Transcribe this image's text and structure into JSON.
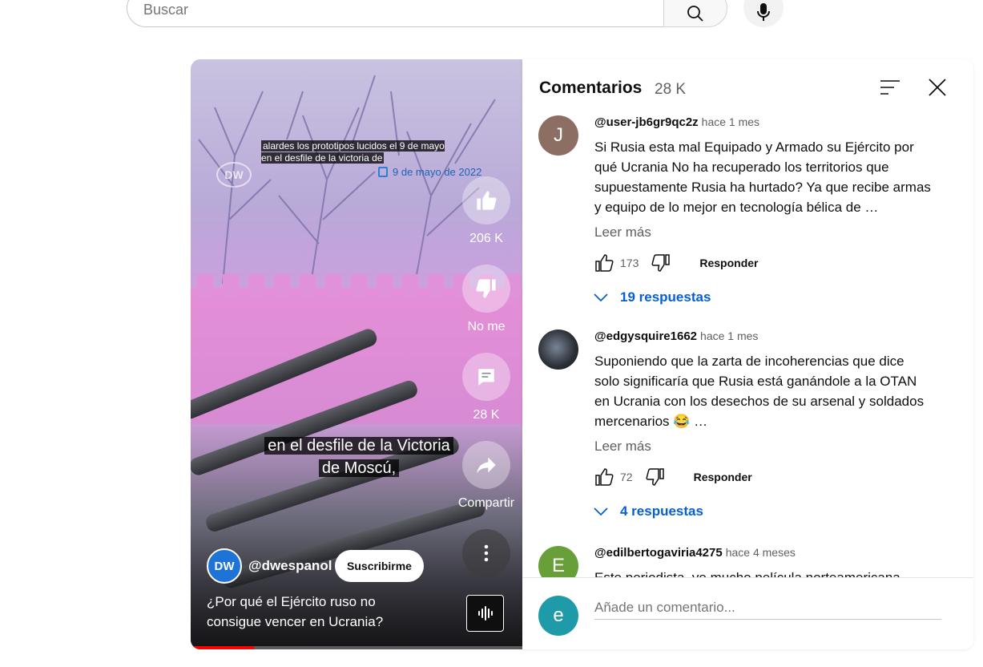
{
  "search": {
    "placeholder": "Buscar"
  },
  "video": {
    "caption_top": "alardes los prototipos lucidos el 9 de mayo en el desfile de la victoria de",
    "date": "9 de mayo de 2022",
    "subtitle_line1": "en el desfile de la Victoria",
    "subtitle_line2": "de Moscú,",
    "like_count": "206 K",
    "dislike_label": "No me",
    "comment_count": "28 K",
    "share_label": "Compartir",
    "channel_handle": "@dwespanol",
    "channel_logo": "DW",
    "subscribe_label": "Suscribirme",
    "title": "¿Por qué el Ejército ruso no consigue vencer en Ucrania?",
    "progress": 0.19
  },
  "comments": {
    "title": "Comentarios",
    "count": "28 K",
    "items": [
      {
        "avatar_letter": "J",
        "avatar_color": "#8d6e63",
        "handle": "@user-jb6gr9qc2z",
        "time": "hace 1 mes",
        "text": "Si Rusia esta mal Equipado y Armado su Ejército por qué Ucrania No ha recuperado los territorios que supuestamente Rusia ha hurtado? Ya que recibe armas y equipo de lo mejor en tecnología bélica de …",
        "read_more": "Leer más",
        "likes": "173",
        "reply_label": "Responder",
        "replies": "19 respuestas"
      },
      {
        "avatar_letter": "",
        "avatar_color": "#2b3038",
        "handle": "@edgysquire1662",
        "time": "hace 1 mes",
        "text": "Suponiendo que la zarta de incoherencias que dice solo significaría que Rusia está ganándole a la OTAN en Ucrania con los desechos de su arsenal y soldados mercenarios 😂 …",
        "read_more": "Leer más",
        "likes": "72",
        "reply_label": "Responder",
        "replies": "4 respuestas"
      },
      {
        "avatar_letter": "E",
        "avatar_color": "#689f38",
        "handle": "@edilbertogaviria4275",
        "time": "hace 4 meses",
        "text": "Este periodista, ve mucho película norteamericana"
      }
    ],
    "add_avatar_letter": "e",
    "add_placeholder": "Añade un comentario..."
  }
}
